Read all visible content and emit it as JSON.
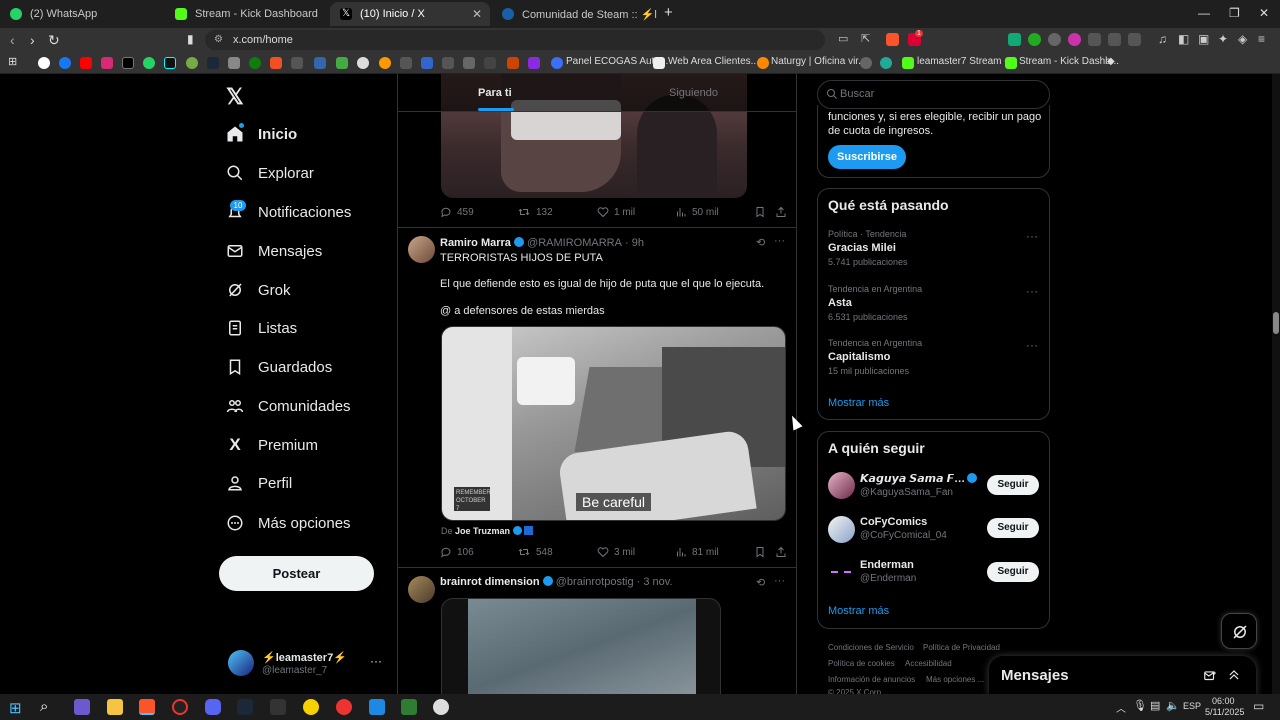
{
  "browser": {
    "tabs": [
      {
        "title": "(2) WhatsApp",
        "color": "#25d366"
      },
      {
        "title": "Stream - Kick Dashboard",
        "color": "#53fc18"
      },
      {
        "title": "(10) Inicio / X",
        "color": "#ffffff"
      },
      {
        "title": "Comunidad de Steam :: ⚡leamaster",
        "color": "#1b2838"
      }
    ],
    "url": "x.com/home",
    "bookmarks": [
      "Panel ECOGAS Auto...",
      "Web Area Clientes...",
      "Naturgy | Oficina vir...",
      "leamaster7 Stream -...",
      "Stream - Kick Dashb..."
    ],
    "ext_badge": "1"
  },
  "sidebar": {
    "items": [
      {
        "label": "Inicio",
        "icon": "home-icon"
      },
      {
        "label": "Explorar",
        "icon": "search-icon"
      },
      {
        "label": "Notificaciones",
        "icon": "bell-icon",
        "badge": "10"
      },
      {
        "label": "Mensajes",
        "icon": "mail-icon"
      },
      {
        "label": "Grok",
        "icon": "grok-icon"
      },
      {
        "label": "Listas",
        "icon": "list-icon"
      },
      {
        "label": "Guardados",
        "icon": "bookmark-icon"
      },
      {
        "label": "Comunidades",
        "icon": "communities-icon"
      },
      {
        "label": "Premium",
        "icon": "x-logo-icon"
      },
      {
        "label": "Perfil",
        "icon": "person-icon"
      },
      {
        "label": "Más opciones",
        "icon": "more-circle-icon"
      }
    ],
    "post_label": "Postear",
    "account": {
      "name": "⚡leamaster7⚡",
      "handle": "@leamaster_7"
    }
  },
  "feed": {
    "tabs": [
      "Para ti",
      "Siguiendo"
    ],
    "tweet1": {
      "replies": "459",
      "retweets": "132",
      "likes": "1 mil",
      "views": "50 mil"
    },
    "tweet2": {
      "name": "Ramiro Marra",
      "handle": "@RAMIROMARRA",
      "time": "· 9h",
      "lines": [
        "TERRORISTAS HIJOS DE PUTA",
        "El que defiende esto es igual de hijo de puta que el que lo ejecuta.",
        "@ a defensores de estas mierdas"
      ],
      "media_caption": "Be careful",
      "media_stamp": "REMEMBER OCTOBER 7",
      "from_prefix": "De",
      "from_name": "Joe Truzman",
      "replies": "106",
      "retweets": "548",
      "likes": "3 mil",
      "views": "81 mil"
    },
    "tweet3": {
      "name": "brainrot dimension",
      "handle": "@brainrotpostig",
      "time": "· 3 nov."
    }
  },
  "right": {
    "search_placeholder": "Buscar",
    "premium_text_1": "funciones y, si eres elegible, recibir un pago",
    "premium_text_2": "de cuota de ingresos.",
    "subscribe_label": "Suscribirse",
    "trends_title": "Qué está pasando",
    "trends": [
      {
        "category": "Política · Tendencia",
        "name": "Gracias Milei",
        "count": "5.741 publicaciones"
      },
      {
        "category": "Tendencia en Argentina",
        "name": "Asta",
        "count": "6.531 publicaciones"
      },
      {
        "category": "Tendencia en Argentina",
        "name": "Capitalismo",
        "count": "15 mil publicaciones"
      }
    ],
    "show_more": "Mostrar más",
    "follow_title": "A quién seguir",
    "follow": [
      {
        "name": "𝙆𝙖𝙜𝙪𝙮𝙖 𝙎𝙖𝙢𝙖 𝙁𝙖𝙣 –...",
        "handle": "@KaguyaSama_Fan",
        "button": "Seguir"
      },
      {
        "name": "CoFyComics",
        "handle": "@CoFyComical_04",
        "button": "Seguir"
      },
      {
        "name": "Enderman",
        "handle": "@Enderman",
        "button": "Seguir"
      }
    ],
    "footer": [
      "Condiciones de Servicio",
      "Política de Privacidad",
      "Política de cookies",
      "Accesibilidad",
      "Información de anuncios",
      "Más opciones ...",
      "© 2025 X Corp."
    ],
    "messages_label": "Mensajes"
  },
  "taskbar": {
    "lang": "ESP",
    "time": "06:00",
    "date": "5/11/2025"
  }
}
